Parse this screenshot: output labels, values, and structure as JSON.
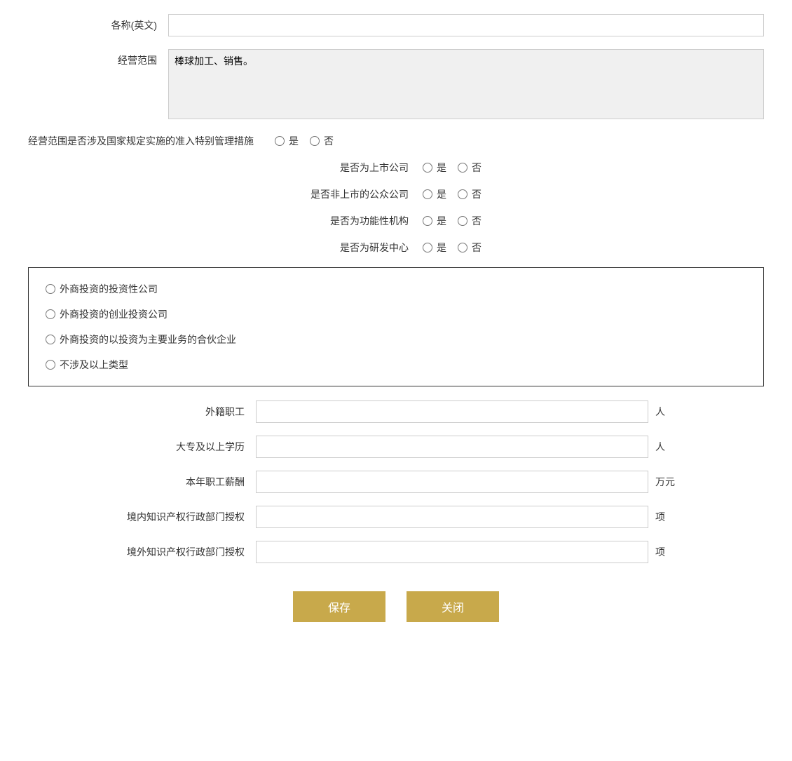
{
  "form": {
    "english_name_label": "各称(英文)",
    "english_name_placeholder": "",
    "business_scope_label": "经营范围",
    "business_scope_value": "棒球加工、销售。",
    "special_mgmt_label": "经营范围是否涉及国家规定实施的准入特别管理措施",
    "yes_label": "是",
    "no_label": "否",
    "listed_company_label": "是否为上市公司",
    "non_listed_public_label": "是否非上市的公众公司",
    "functional_org_label": "是否为功能性机构",
    "rd_center_label": "是否为研发中心",
    "foreign_investment_options": [
      "外商投资的投资性公司",
      "外商投资的创业投资公司",
      "外商投资的以投资为主要业务的合伙企业",
      "不涉及以上类型"
    ],
    "foreign_workers_label": "外籍职工",
    "foreign_workers_suffix": "人",
    "college_degree_label": "大专及以上学历",
    "college_degree_suffix": "人",
    "annual_salary_label": "本年职工薪酬",
    "annual_salary_suffix": "万元",
    "domestic_ip_label": "境内知识产权行政部门授权",
    "domestic_ip_suffix": "项",
    "foreign_ip_label": "境外知识产权行政部门授权",
    "foreign_ip_suffix": "项",
    "save_button": "保存",
    "close_button": "关闭"
  }
}
